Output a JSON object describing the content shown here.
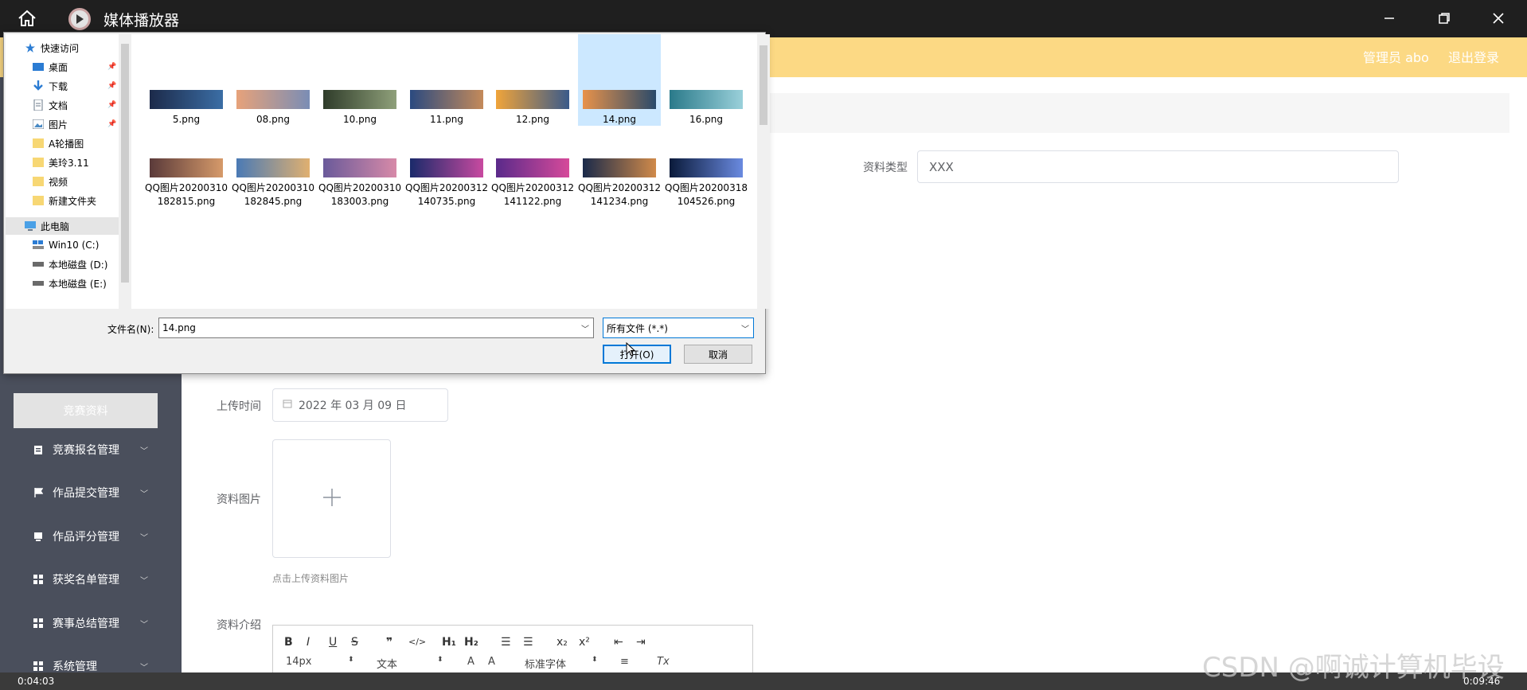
{
  "window": {
    "title": "媒体播放器",
    "home_icon": "home-icon",
    "logo_icon": "play-logo-icon"
  },
  "header": {
    "admin": "管理员 abo",
    "logout": "退出登录",
    "color": "#fcd984"
  },
  "sidebar": {
    "sub_active": "竞赛资料",
    "items": [
      {
        "label": "竞赛报名管理",
        "icon": "clipboard-icon"
      },
      {
        "label": "作品提交管理",
        "icon": "flag-icon"
      },
      {
        "label": "作品评分管理",
        "icon": "card-icon"
      },
      {
        "label": "获奖名单管理",
        "icon": "grid-icon"
      },
      {
        "label": "赛事总结管理",
        "icon": "grid-icon"
      },
      {
        "label": "系统管理",
        "icon": "grid-icon"
      }
    ]
  },
  "form": {
    "type_label": "资料类型",
    "type_value": "XXX",
    "upload_time_label": "上传时间",
    "upload_time_value": "2022 年 03 月 09 日",
    "image_label": "资料图片",
    "image_hint": "点击上传资料图片",
    "intro_label": "资料介绍"
  },
  "editor": {
    "font_size": "14px",
    "block_type": "文本",
    "font_family": "标准字体",
    "toolbar_icons": [
      "bold-icon",
      "italic-icon",
      "underline-icon",
      "strike-icon",
      "quote-icon",
      "code-icon",
      "h1-icon",
      "h2-icon",
      "ordered-list-icon",
      "bullet-list-icon",
      "subscript-icon",
      "superscript-icon",
      "outdent-icon",
      "indent-icon"
    ]
  },
  "bottombar": {
    "time_left": "0:04:03",
    "time_right": "0:09:46"
  },
  "watermark": "CSDN @啊诚计算机毕设",
  "dialog": {
    "nav": {
      "quick_access": "快速访问",
      "items": [
        {
          "label": "桌面",
          "icon": "desktop-icon",
          "pinned": true
        },
        {
          "label": "下载",
          "icon": "download-icon",
          "pinned": true
        },
        {
          "label": "文档",
          "icon": "document-icon",
          "pinned": true
        },
        {
          "label": "图片",
          "icon": "pictures-icon",
          "pinned": true
        },
        {
          "label": "A轮播图",
          "icon": "folder-icon",
          "pinned": false
        },
        {
          "label": "美玲3.11",
          "icon": "folder-icon",
          "pinned": false
        },
        {
          "label": "视频",
          "icon": "folder-icon",
          "pinned": false
        },
        {
          "label": "新建文件夹",
          "icon": "folder-icon",
          "pinned": false
        }
      ],
      "this_pc": "此电脑",
      "drives": [
        {
          "label": "Win10 (C:)",
          "icon": "windows-drive-icon"
        },
        {
          "label": "本地磁盘 (D:)",
          "icon": "drive-icon"
        },
        {
          "label": "本地磁盘 (E:)",
          "icon": "drive-icon"
        }
      ]
    },
    "files_row1": [
      {
        "name": "5.png",
        "colors": [
          "#1c2a4a",
          "#3b6ea5"
        ]
      },
      {
        "name": "08.png",
        "colors": [
          "#e7a27a",
          "#7a8db5"
        ]
      },
      {
        "name": "10.png",
        "colors": [
          "#2f3c2a",
          "#8fa07a"
        ]
      },
      {
        "name": "11.png",
        "colors": [
          "#2b4a80",
          "#c48a5a"
        ]
      },
      {
        "name": "12.png",
        "colors": [
          "#f0a43a",
          "#3a5a8a"
        ]
      },
      {
        "name": "14.png",
        "colors": [
          "#e8924a",
          "#2a4a6a"
        ],
        "selected": true
      },
      {
        "name": "16.png",
        "colors": [
          "#2a7a8a",
          "#9ad0da"
        ]
      }
    ],
    "files_row2": [
      {
        "name": "QQ图片20200310182815.png",
        "colors": [
          "#5a3a3a",
          "#d69a6a"
        ]
      },
      {
        "name": "QQ图片20200310182845.png",
        "colors": [
          "#4a7ab5",
          "#e0b070"
        ]
      },
      {
        "name": "QQ图片20200310183003.png",
        "colors": [
          "#6a5a9a",
          "#d78aa8"
        ]
      },
      {
        "name": "QQ图片20200312140735.png",
        "colors": [
          "#1a2a6a",
          "#c84aa0"
        ]
      },
      {
        "name": "QQ图片20200312141122.png",
        "colors": [
          "#5a2a8a",
          "#d64a9a"
        ]
      },
      {
        "name": "QQ图片20200312141234.png",
        "colors": [
          "#1a2a4a",
          "#d08a4a"
        ]
      },
      {
        "name": "QQ图片20200318104526.png",
        "colors": [
          "#0a1a3a",
          "#6a8ae0"
        ]
      }
    ],
    "filename_label": "文件名(N):",
    "filename_value": "14.png",
    "filetype_value": "所有文件 (*.*)",
    "open_button": "打开(O)",
    "cancel_button": "取消"
  }
}
